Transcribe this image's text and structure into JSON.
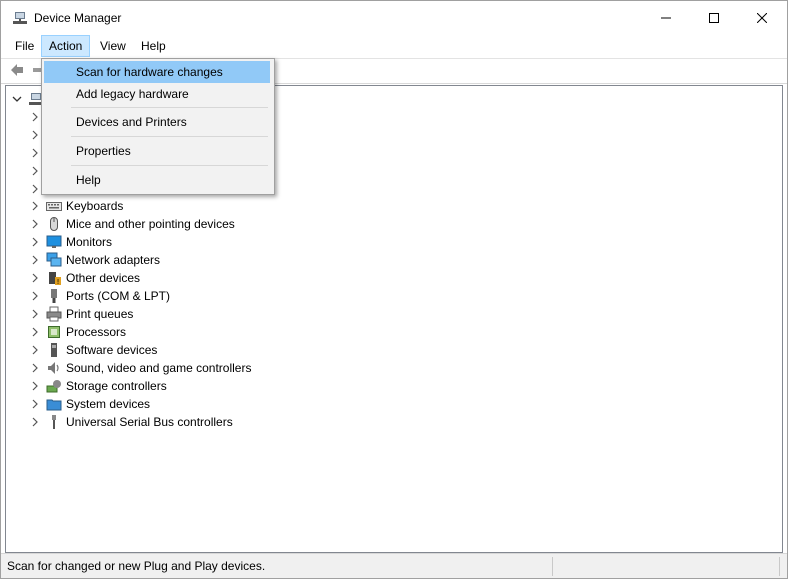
{
  "window": {
    "title": "Device Manager"
  },
  "menubar": {
    "file": "File",
    "action": "Action",
    "view": "View",
    "help": "Help"
  },
  "action_menu": {
    "items": [
      {
        "label": "Scan for hardware changes",
        "highlighted": true
      },
      {
        "label": "Add legacy hardware"
      },
      {
        "label": "Devices and Printers"
      },
      {
        "label": "Properties"
      },
      {
        "label": "Help"
      }
    ]
  },
  "tree": {
    "items": [
      {
        "label": "Keyboards",
        "icon": "keyboard-icon"
      },
      {
        "label": "Mice and other pointing devices",
        "icon": "mouse-icon"
      },
      {
        "label": "Monitors",
        "icon": "monitor-icon"
      },
      {
        "label": "Network adapters",
        "icon": "network-adapter-icon"
      },
      {
        "label": "Other devices",
        "icon": "other-devices-icon"
      },
      {
        "label": "Ports (COM & LPT)",
        "icon": "port-icon"
      },
      {
        "label": "Print queues",
        "icon": "printer-icon"
      },
      {
        "label": "Processors",
        "icon": "processor-icon"
      },
      {
        "label": "Software devices",
        "icon": "software-device-icon"
      },
      {
        "label": "Sound, video and game controllers",
        "icon": "speaker-icon"
      },
      {
        "label": "Storage controllers",
        "icon": "storage-icon"
      },
      {
        "label": "System devices",
        "icon": "system-folder-icon"
      },
      {
        "label": "Universal Serial Bus controllers",
        "icon": "usb-icon"
      }
    ]
  },
  "statusbar": {
    "text": "Scan for changed or new Plug and Play devices."
  },
  "colors": {
    "highlight": "#91c9f7",
    "menu_active": "#cce8ff",
    "monitor_blue": "#1e90e0"
  }
}
